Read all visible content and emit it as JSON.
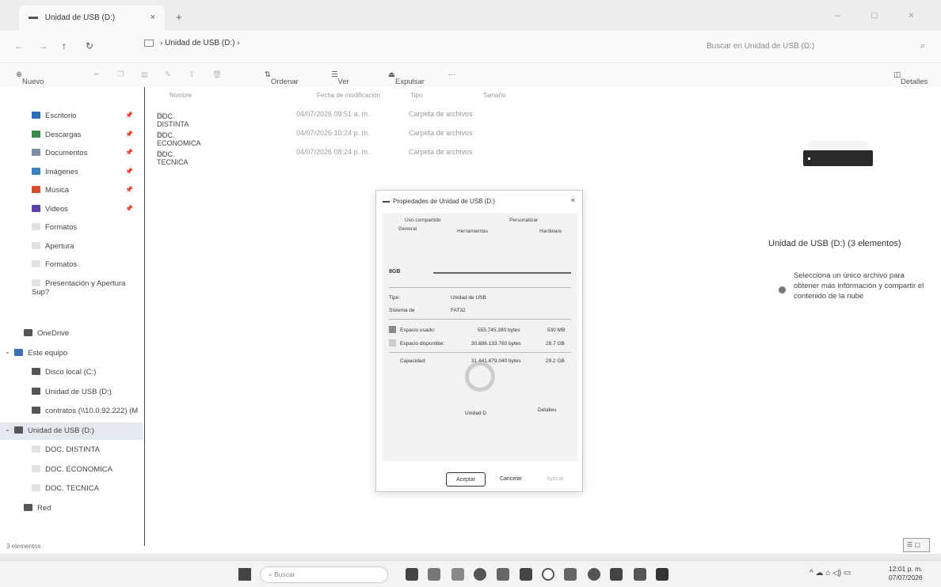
{
  "window": {
    "tab_title": "Unidad de USB (D:)",
    "tab_close": "×",
    "new_tab": "+",
    "window_controls": "– □ ×"
  },
  "address": {
    "breadcrumb": "›  Unidad de USB (D:)  ›",
    "search_placeholder": "Buscar en Unidad de USB (D:)"
  },
  "commandbar": {
    "new_label": "Nuevo",
    "sort_label": "Ordenar",
    "view_label": "Ver",
    "eject_label": "Expulsar",
    "more_label": "···",
    "details_label": "Detalles"
  },
  "sidebar": {
    "quick": [
      {
        "label": "Escritorio",
        "color": "#2f6fb5"
      },
      {
        "label": "Descargas",
        "color": "#3a8a4a"
      },
      {
        "label": "Documentos",
        "color": "#7d8ea6"
      },
      {
        "label": "Imágenes",
        "color": "#3a7fc1"
      },
      {
        "label": "Música",
        "color": "#d0502f"
      },
      {
        "label": "Videos",
        "color": "#5a3fa8"
      },
      {
        "label": "Formatos",
        "color": "#e2e2e2"
      },
      {
        "label": "Apertura",
        "color": "#e2e2e2"
      },
      {
        "label": "Formatos",
        "color": "#e2e2e2"
      },
      {
        "label": "Presentación y Apertura Sup?",
        "color": "#e2e2e2"
      }
    ],
    "tree": [
      {
        "label": "OneDrive",
        "color": "#555555",
        "indent": 24
      },
      {
        "label": "Este equipo",
        "color": "#3a6fb0",
        "indent": 12,
        "chev": "⌄"
      },
      {
        "label": "Disco local (C:)",
        "color": "#555555",
        "indent": 34
      },
      {
        "label": "Unidad de USB (D:)",
        "color": "#555555",
        "indent": 34
      },
      {
        "label": "contratos (\\\\10.0.92.222) (M",
        "color": "#555555",
        "indent": 34
      },
      {
        "label": "Unidad de USB (D:)",
        "color": "#555555",
        "indent": 12,
        "chev": "⌄",
        "selected": true
      },
      {
        "label": "DOC. DISTINTA",
        "color": "#e2e2e2",
        "indent": 34
      },
      {
        "label": "DOC. ECONOMICA",
        "color": "#e2e2e2",
        "indent": 34
      },
      {
        "label": "DOC. TECNICA",
        "color": "#e2e2e2",
        "indent": 34
      },
      {
        "label": "Red",
        "color": "#555555",
        "indent": 24
      }
    ]
  },
  "filelist": {
    "headers": {
      "name": "Nombre",
      "date": "Fecha de modificación",
      "type": "Tipo",
      "size": "Tamaño"
    },
    "rows": [
      {
        "name": "DOC. DISTINTA",
        "date": "04/07/2026 09:51 a. m.",
        "type": "Carpeta de archivos"
      },
      {
        "name": "DOC. ECONOMICA",
        "date": "04/07/2026 10:24 p. m.",
        "type": "Carpeta de archivos"
      },
      {
        "name": "DOC. TECNICA",
        "date": "04/07/2026 08:24 p. m.",
        "type": "Carpeta de archivos"
      }
    ]
  },
  "details": {
    "title": "Unidad de USB (D:) (3 elementos)",
    "hint": "Selecciona un único archivo para obtener más información y compartir el contenido de la nube"
  },
  "status": {
    "count": "3 elementos",
    "view_buttons": "☰ ▢"
  },
  "taskbar": {
    "search": "Buscar",
    "tray": "^  ☁  ⌂ ◁) ▭",
    "time": "12:01 p. m.",
    "date": "07/07/2026"
  },
  "dialog": {
    "title": "Propiedades de Unidad de USB (D:)",
    "close": "×",
    "tabs": {
      "shared": "Uso compartido",
      "customize": "Personalizar",
      "general": "General",
      "tools": "Herramientas",
      "hardware": "Hardware"
    },
    "label_value": "8GB",
    "type_label": "Tipo:",
    "type_value": "Unidad de USB",
    "fs_label": "Sistema de",
    "fs_value": "FAT32",
    "used_label": "Espacio usado:",
    "used_bytes": "555.745.280 bytes",
    "used_human": "530 MB",
    "free_label": "Espacio disponible:",
    "free_bytes": "30.886.133.760 bytes",
    "free_human": "28.7 GB",
    "cap_label": "Capacidad:",
    "cap_bytes": "31.441.879.040 bytes",
    "cap_human": "29.2 GB",
    "drive_label": "Unidad D",
    "details_button": "Detalles",
    "ok": "Aceptar",
    "cancel": "Cancelar",
    "apply": "Aplicar",
    "used_color": "#8a8a8a",
    "free_color": "#cccccc"
  }
}
